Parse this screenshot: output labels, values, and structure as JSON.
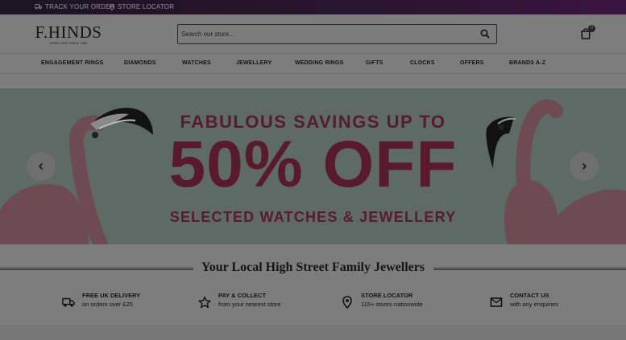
{
  "topbar": {
    "track_order": "TRACK YOUR ORDER",
    "store_locator": "STORE LOCATOR"
  },
  "header": {
    "logo_text": "F.HINDS",
    "logo_tagline": "JEWELLERS SINCE 1856",
    "search_placeholder": "Search our store...",
    "cart_count": "0"
  },
  "nav": {
    "items": [
      {
        "label": "ENGAGEMENT RINGS"
      },
      {
        "label": "DIAMONDS"
      },
      {
        "label": "WATCHES"
      },
      {
        "label": "JEWELLERY"
      },
      {
        "label": "WEDDING RINGS"
      },
      {
        "label": "GIFTS"
      },
      {
        "label": "CLOCKS"
      },
      {
        "label": "OFFERS"
      },
      {
        "label": "BRANDS A-Z"
      }
    ]
  },
  "hero": {
    "line1": "FABULOUS SAVINGS UP TO",
    "line2": "50% OFF",
    "line3": "SELECTED WATCHES & JEWELLERY",
    "background_color": "#5d6a66",
    "text_color": "#5a1a2e"
  },
  "tagline": "Your Local High Street Family Jewellers",
  "features": [
    {
      "title": "FREE UK DELIVERY",
      "subtitle": "on orders over £25",
      "icon": "truck-icon"
    },
    {
      "title": "PAY & COLLECT",
      "subtitle": "from your nearest store",
      "icon": "star-icon"
    },
    {
      "title": "STORE LOCATOR",
      "subtitle": "115+ stores nationwide",
      "icon": "map-pin-icon"
    },
    {
      "title": "CONTACT US",
      "subtitle": "with any enquiries",
      "icon": "envelope-icon"
    }
  ]
}
